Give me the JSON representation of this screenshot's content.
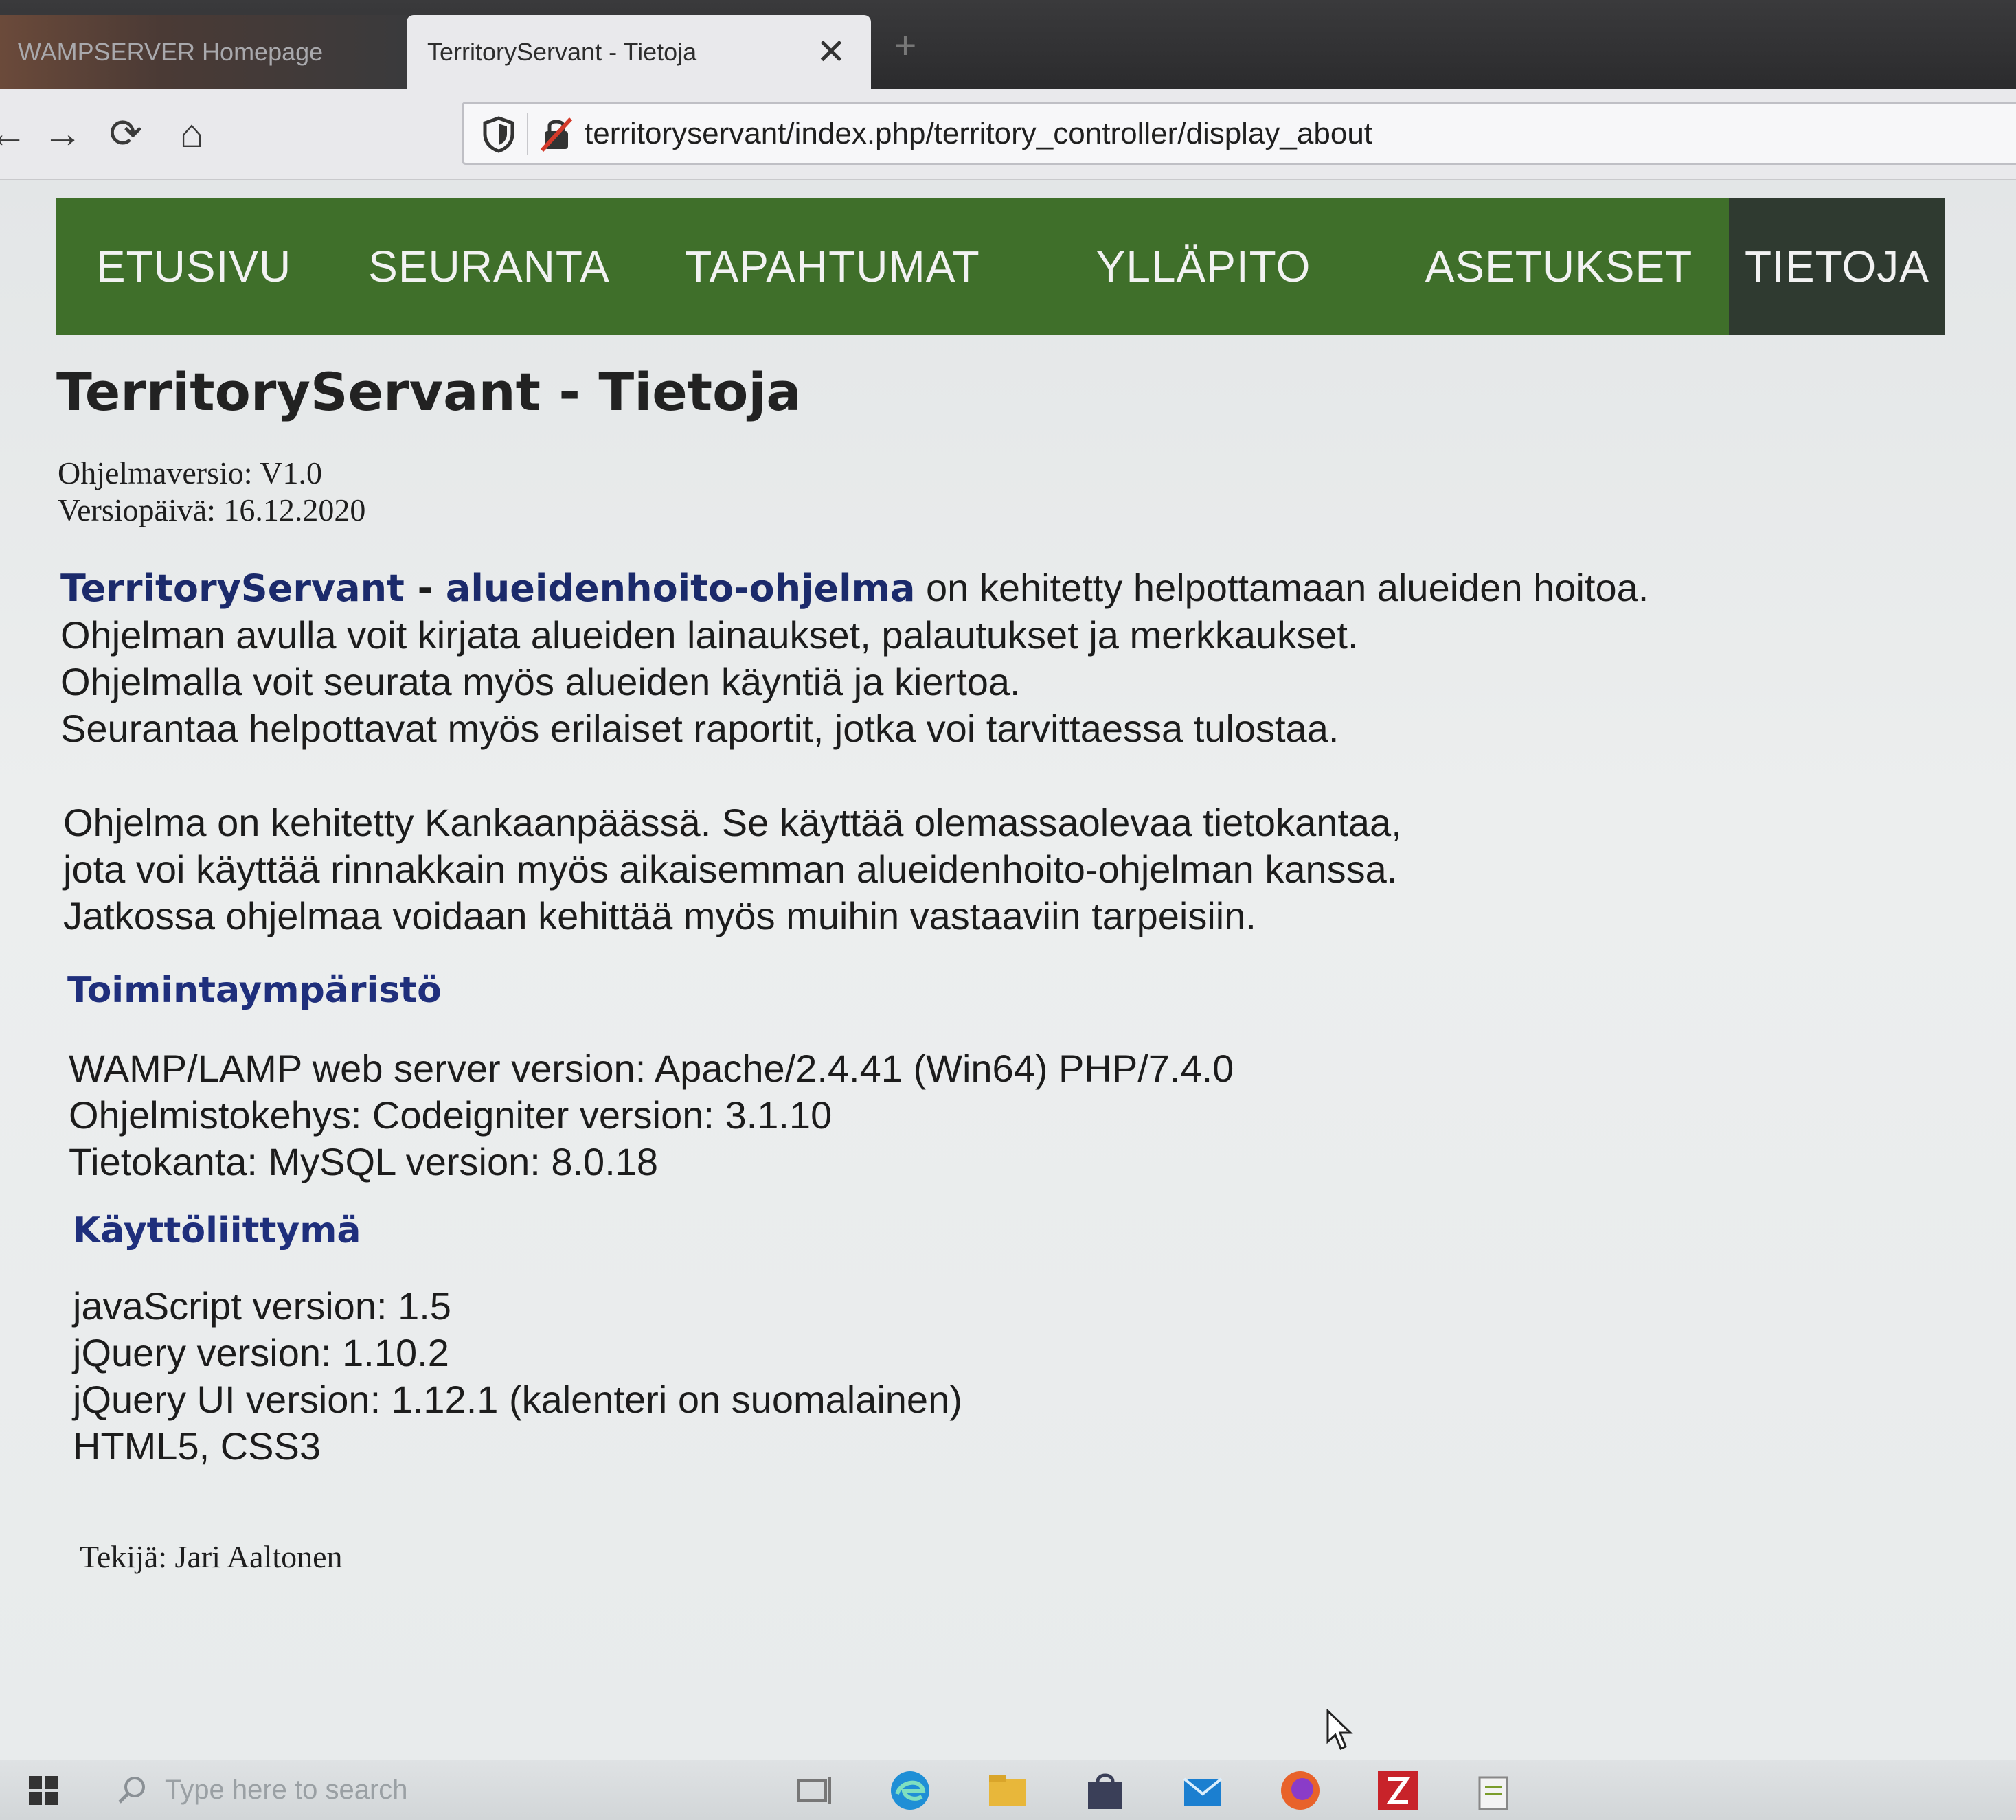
{
  "browser": {
    "tabs": [
      {
        "label": "WAMPSERVER Homepage",
        "active": false
      },
      {
        "label": "TerritoryServant - Tietoja",
        "active": true
      }
    ],
    "close_glyph": "✕",
    "new_tab_glyph": "+",
    "url": "territoryservant/index.php/territory_controller/display_about",
    "nav": {
      "back": "←",
      "forward": "→",
      "reload": "⟳",
      "home": "⌂"
    }
  },
  "menu": {
    "items": [
      "ETUSIVU",
      "SEURANTA",
      "TAPAHTUMAT",
      "YLLÄPITO",
      "ASETUKSET",
      "TIETOJA"
    ],
    "active_index": 5,
    "bar_color": "#3f6f2a",
    "active_color": "#2f3a30"
  },
  "page": {
    "title": "TerritoryServant - Tietoja",
    "version_line": "Ohjelmaversio: V1.0",
    "date_line": "Versiopäivä: 16.12.2020",
    "intro": {
      "brand_name": "TerritoryServant",
      "brand_sep": " - ",
      "brand_sub": "alueidenhoito-ohjelma",
      "line1_rest": " on kehitetty helpottamaan alueiden hoitoa.",
      "line2": "Ohjelman avulla voit kirjata alueiden lainaukset, palautukset ja merkkaukset.",
      "line3": "Ohjelmalla voit seurata myös alueiden käyntiä ja kiertoa.",
      "line4": "Seurantaa helpottavat myös erilaiset raportit, jotka voi tarvittaessa tulostaa."
    },
    "para2": [
      "Ohjelma on kehitetty Kankaanpäässä. Se käyttää olemassaolevaa tietokantaa,",
      "jota voi käyttää rinnakkain myös aikaisemman alueidenhoito-ohjelman kanssa.",
      "Jatkossa ohjelmaa voidaan kehittää myös muihin vastaaviin tarpeisiin."
    ],
    "env_heading": "Toimintaympäristö",
    "env_lines": [
      "WAMP/LAMP web server version: Apache/2.4.41 (Win64) PHP/7.4.0",
      "Ohjelmistokehys: Codeigniter version: 3.1.10",
      "Tietokanta: MySQL version: 8.0.18"
    ],
    "ui_heading": "Käyttöliittymä",
    "ui_lines": [
      "javaScript version: 1.5",
      "jQuery version: 1.10.2",
      "jQuery UI version: 1.12.1 (kalenteri on suomalainen)",
      "HTML5, CSS3"
    ],
    "author": "Tekijä: Jari Aaltonen"
  },
  "taskbar": {
    "search_placeholder": "Type here to search",
    "icons": [
      "start-icon",
      "search-icon",
      "task-view-icon",
      "edge-icon",
      "file-explorer-icon",
      "store-icon",
      "mail-icon",
      "firefox-icon",
      "filezilla-icon",
      "notepad-icon"
    ]
  }
}
